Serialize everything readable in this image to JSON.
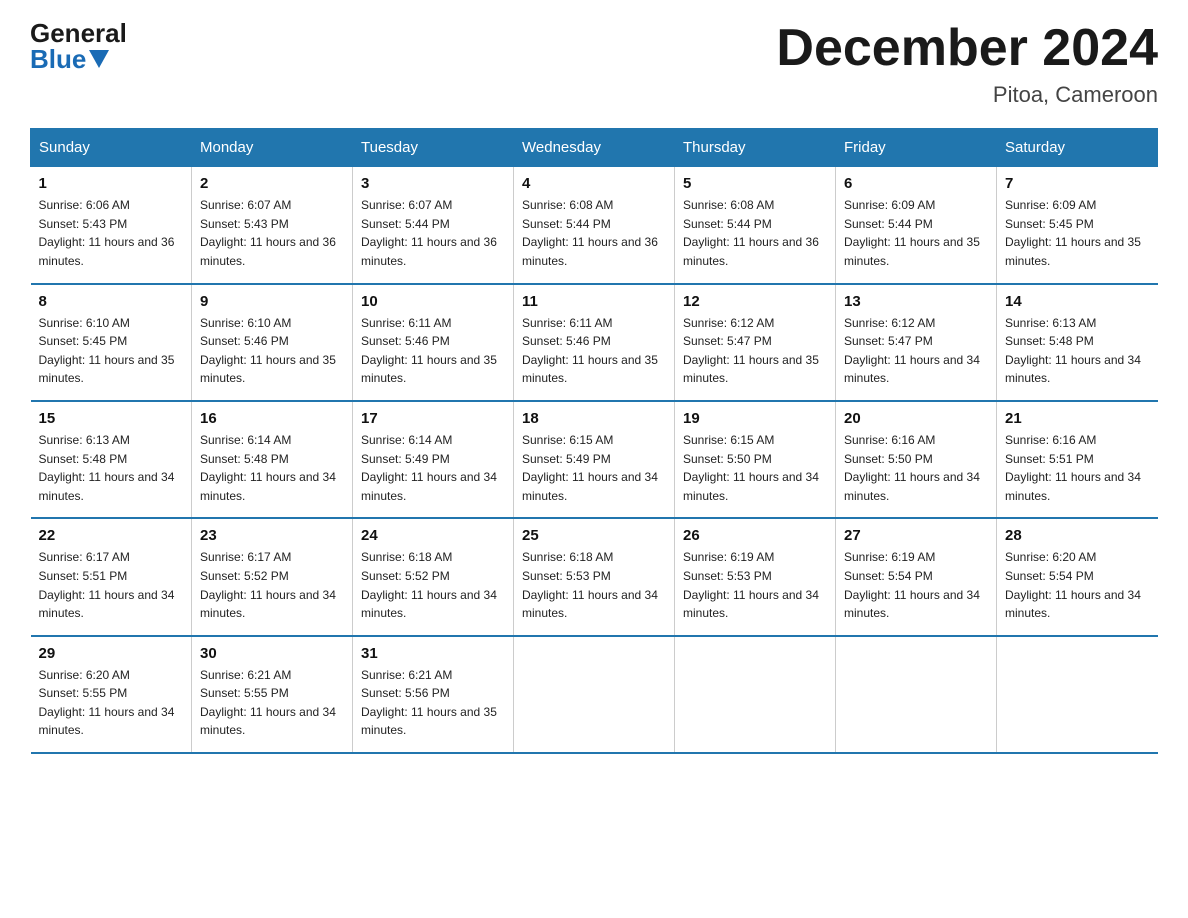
{
  "logo": {
    "general": "General",
    "blue": "Blue"
  },
  "title": "December 2024",
  "subtitle": "Pitoa, Cameroon",
  "days_of_week": [
    "Sunday",
    "Monday",
    "Tuesday",
    "Wednesday",
    "Thursday",
    "Friday",
    "Saturday"
  ],
  "weeks": [
    [
      {
        "day": "1",
        "sunrise": "6:06 AM",
        "sunset": "5:43 PM",
        "daylight": "11 hours and 36 minutes."
      },
      {
        "day": "2",
        "sunrise": "6:07 AM",
        "sunset": "5:43 PM",
        "daylight": "11 hours and 36 minutes."
      },
      {
        "day": "3",
        "sunrise": "6:07 AM",
        "sunset": "5:44 PM",
        "daylight": "11 hours and 36 minutes."
      },
      {
        "day": "4",
        "sunrise": "6:08 AM",
        "sunset": "5:44 PM",
        "daylight": "11 hours and 36 minutes."
      },
      {
        "day": "5",
        "sunrise": "6:08 AM",
        "sunset": "5:44 PM",
        "daylight": "11 hours and 36 minutes."
      },
      {
        "day": "6",
        "sunrise": "6:09 AM",
        "sunset": "5:44 PM",
        "daylight": "11 hours and 35 minutes."
      },
      {
        "day": "7",
        "sunrise": "6:09 AM",
        "sunset": "5:45 PM",
        "daylight": "11 hours and 35 minutes."
      }
    ],
    [
      {
        "day": "8",
        "sunrise": "6:10 AM",
        "sunset": "5:45 PM",
        "daylight": "11 hours and 35 minutes."
      },
      {
        "day": "9",
        "sunrise": "6:10 AM",
        "sunset": "5:46 PM",
        "daylight": "11 hours and 35 minutes."
      },
      {
        "day": "10",
        "sunrise": "6:11 AM",
        "sunset": "5:46 PM",
        "daylight": "11 hours and 35 minutes."
      },
      {
        "day": "11",
        "sunrise": "6:11 AM",
        "sunset": "5:46 PM",
        "daylight": "11 hours and 35 minutes."
      },
      {
        "day": "12",
        "sunrise": "6:12 AM",
        "sunset": "5:47 PM",
        "daylight": "11 hours and 35 minutes."
      },
      {
        "day": "13",
        "sunrise": "6:12 AM",
        "sunset": "5:47 PM",
        "daylight": "11 hours and 34 minutes."
      },
      {
        "day": "14",
        "sunrise": "6:13 AM",
        "sunset": "5:48 PM",
        "daylight": "11 hours and 34 minutes."
      }
    ],
    [
      {
        "day": "15",
        "sunrise": "6:13 AM",
        "sunset": "5:48 PM",
        "daylight": "11 hours and 34 minutes."
      },
      {
        "day": "16",
        "sunrise": "6:14 AM",
        "sunset": "5:48 PM",
        "daylight": "11 hours and 34 minutes."
      },
      {
        "day": "17",
        "sunrise": "6:14 AM",
        "sunset": "5:49 PM",
        "daylight": "11 hours and 34 minutes."
      },
      {
        "day": "18",
        "sunrise": "6:15 AM",
        "sunset": "5:49 PM",
        "daylight": "11 hours and 34 minutes."
      },
      {
        "day": "19",
        "sunrise": "6:15 AM",
        "sunset": "5:50 PM",
        "daylight": "11 hours and 34 minutes."
      },
      {
        "day": "20",
        "sunrise": "6:16 AM",
        "sunset": "5:50 PM",
        "daylight": "11 hours and 34 minutes."
      },
      {
        "day": "21",
        "sunrise": "6:16 AM",
        "sunset": "5:51 PM",
        "daylight": "11 hours and 34 minutes."
      }
    ],
    [
      {
        "day": "22",
        "sunrise": "6:17 AM",
        "sunset": "5:51 PM",
        "daylight": "11 hours and 34 minutes."
      },
      {
        "day": "23",
        "sunrise": "6:17 AM",
        "sunset": "5:52 PM",
        "daylight": "11 hours and 34 minutes."
      },
      {
        "day": "24",
        "sunrise": "6:18 AM",
        "sunset": "5:52 PM",
        "daylight": "11 hours and 34 minutes."
      },
      {
        "day": "25",
        "sunrise": "6:18 AM",
        "sunset": "5:53 PM",
        "daylight": "11 hours and 34 minutes."
      },
      {
        "day": "26",
        "sunrise": "6:19 AM",
        "sunset": "5:53 PM",
        "daylight": "11 hours and 34 minutes."
      },
      {
        "day": "27",
        "sunrise": "6:19 AM",
        "sunset": "5:54 PM",
        "daylight": "11 hours and 34 minutes."
      },
      {
        "day": "28",
        "sunrise": "6:20 AM",
        "sunset": "5:54 PM",
        "daylight": "11 hours and 34 minutes."
      }
    ],
    [
      {
        "day": "29",
        "sunrise": "6:20 AM",
        "sunset": "5:55 PM",
        "daylight": "11 hours and 34 minutes."
      },
      {
        "day": "30",
        "sunrise": "6:21 AM",
        "sunset": "5:55 PM",
        "daylight": "11 hours and 34 minutes."
      },
      {
        "day": "31",
        "sunrise": "6:21 AM",
        "sunset": "5:56 PM",
        "daylight": "11 hours and 35 minutes."
      },
      null,
      null,
      null,
      null
    ]
  ]
}
